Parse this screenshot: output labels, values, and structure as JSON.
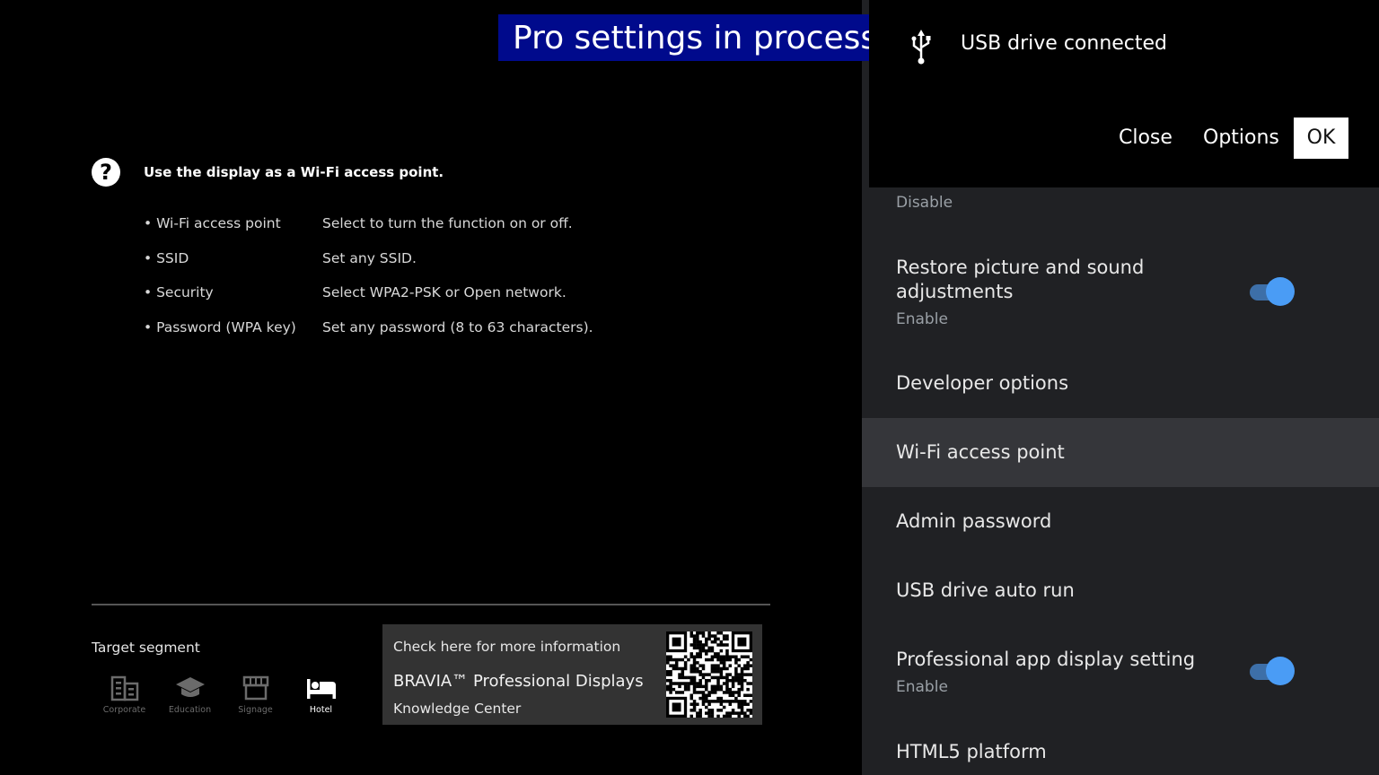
{
  "banner": "Pro settings in process",
  "help": {
    "icon": "question-circle-icon",
    "title": "Use the display as a Wi-Fi access point.",
    "rows": [
      {
        "term": "• Wi-Fi access point",
        "desc": "Select to turn the function on or off."
      },
      {
        "term": "• SSID",
        "desc": "Set any SSID."
      },
      {
        "term": "• Security",
        "desc": "Select WPA2-PSK or Open network."
      },
      {
        "term": "• Password (WPA key)",
        "desc": "Set any password (8 to 63 characters)."
      }
    ]
  },
  "target_segment": {
    "label": "Target segment",
    "items": [
      {
        "label": "Corporate",
        "icon": "building-icon",
        "active": false
      },
      {
        "label": "Education",
        "icon": "graduation-cap-icon",
        "active": false
      },
      {
        "label": "Signage",
        "icon": "storefront-icon",
        "active": false
      },
      {
        "label": "Hotel",
        "icon": "bed-icon",
        "active": true
      }
    ]
  },
  "info": {
    "check": "Check here for more information",
    "brand": "BRAVIA™ Professional Displays",
    "center": "Knowledge Center",
    "qr_icon": "qr-code-icon"
  },
  "notification": {
    "icon": "usb-icon",
    "title": "USB drive connected",
    "close": "Close",
    "options": "Options",
    "ok": "OK"
  },
  "settings": {
    "partial_sub": "Disable",
    "items": [
      {
        "title": "Restore picture and sound adjustments",
        "sub": "Enable",
        "toggle": true
      },
      {
        "title": "Developer options"
      },
      {
        "title": "Wi-Fi access point",
        "selected": true
      },
      {
        "title": "Admin password"
      },
      {
        "title": "USB drive auto run"
      },
      {
        "title": "Professional app display setting",
        "sub": "Enable",
        "toggle": true
      },
      {
        "title": "HTML5 platform"
      }
    ]
  },
  "colors": {
    "banner_bg": "#000a8c",
    "panel_bg": "#202124",
    "selected_bg": "#35363a",
    "toggle_on": "#4a9cf5"
  }
}
